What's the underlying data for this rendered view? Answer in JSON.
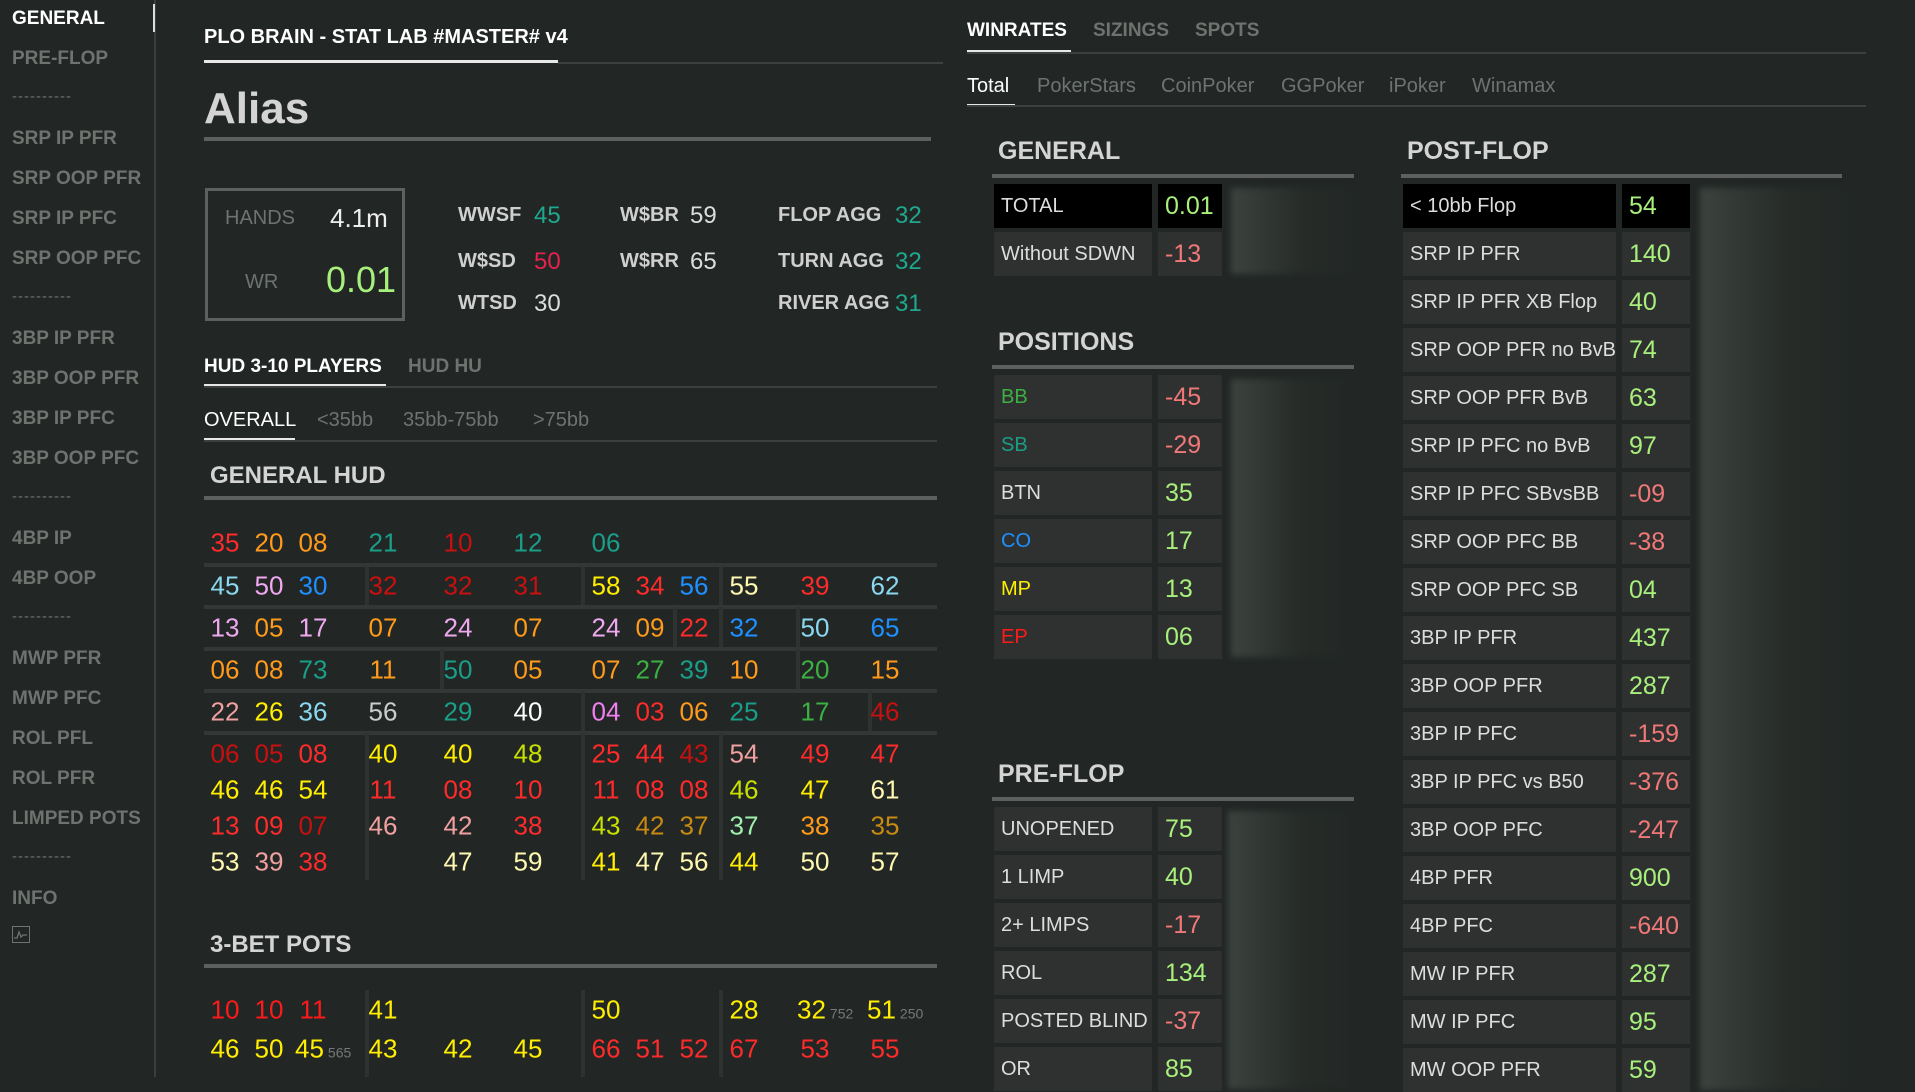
{
  "sidebar": {
    "items": [
      "GENERAL",
      "PRE-FLOP",
      "----------",
      "SRP IP PFR",
      "SRP OOP PFR",
      "SRP IP PFC",
      "SRP OOP PFC",
      "----------",
      "3BP IP PFR",
      "3BP OOP PFR",
      "3BP IP PFC",
      "3BP OOP PFC",
      "----------",
      "4BP IP",
      "4BP OOP",
      "----------",
      "MWP PFR",
      "MWP PFC",
      "ROL PFL",
      "ROL PFR",
      "LIMPED POTS",
      "----------",
      "INFO"
    ],
    "active": 0,
    "icon": "chart-icon"
  },
  "header": {
    "title": "PLO BRAIN - STAT LAB #MASTER# v4",
    "alias": "Alias"
  },
  "summary": {
    "hands_label": "HANDS",
    "hands": "4.1m",
    "wr_label": "WR",
    "wr": "0.01"
  },
  "stats": [
    {
      "label": "WWSF",
      "value": "45",
      "color": "#1fa88f"
    },
    {
      "label": "W$SD",
      "value": "50",
      "color": "#e8204f"
    },
    {
      "label": "WTSD",
      "value": "30",
      "color": "#dddddd"
    },
    {
      "label": "W$BR",
      "value": "59",
      "color": "#dddddd"
    },
    {
      "label": "W$RR",
      "value": "65",
      "color": "#dddddd"
    },
    {
      "label": "FLOP AGG",
      "value": "32",
      "color": "#1fa88f"
    },
    {
      "label": "TURN AGG",
      "value": "32",
      "color": "#1fa88f"
    },
    {
      "label": "RIVER AGG",
      "value": "31",
      "color": "#1fa88f"
    }
  ],
  "hud_tabs": [
    "HUD 3-10 PLAYERS",
    "HUD HU"
  ],
  "stack_tabs": [
    "OVERALL",
    "<35bb",
    "35bb-75bb",
    ">75bb"
  ],
  "general_hud": {
    "title": "GENERAL HUD",
    "rows": [
      [
        [
          0,
          "35",
          "#ff2a2a"
        ],
        [
          1,
          "20",
          "#ff9a1a"
        ],
        [
          2,
          "08",
          "#ff9a1a"
        ],
        [
          3,
          "21",
          "#1a9e88"
        ],
        [
          4,
          "10",
          "#c81010"
        ],
        [
          5,
          "12",
          "#1a9e88"
        ],
        [
          6,
          "06",
          "#1a9e88"
        ]
      ],
      [
        [
          0,
          "45",
          "#8ad8f0"
        ],
        [
          1,
          "50",
          "#f0a8f0"
        ],
        [
          2,
          "30",
          "#1e90ff"
        ],
        [
          3,
          "32",
          "#c81010"
        ],
        [
          4,
          "32",
          "#c81010"
        ],
        [
          5,
          "31",
          "#c81010"
        ],
        [
          6,
          "58",
          "#ffee00"
        ],
        [
          7,
          "34",
          "#ff2a2a"
        ],
        [
          8,
          "56",
          "#1e90ff"
        ],
        [
          9,
          "55",
          "#fff8b0"
        ],
        [
          10,
          "39",
          "#ff2a2a"
        ],
        [
          11,
          "62",
          "#8ad8f0"
        ]
      ],
      [
        [
          0,
          "13",
          "#f0a8f0"
        ],
        [
          1,
          "05",
          "#ff9a1a"
        ],
        [
          2,
          "17",
          "#f0a8f0"
        ],
        [
          3,
          "07",
          "#ff9a1a"
        ],
        [
          4,
          "24",
          "#f0a8f0"
        ],
        [
          5,
          "07",
          "#ff9a1a"
        ],
        [
          6,
          "24",
          "#f0a8f0"
        ],
        [
          7,
          "09",
          "#ff9a1a"
        ],
        [
          8,
          "22",
          "#ff2a2a"
        ],
        [
          9,
          "32",
          "#1e90ff"
        ],
        [
          10,
          "50",
          "#8ad8f0"
        ],
        [
          11,
          "65",
          "#1e90ff"
        ]
      ],
      [
        [
          0,
          "06",
          "#ff9a1a"
        ],
        [
          1,
          "08",
          "#ff9a1a"
        ],
        [
          2,
          "73",
          "#1a9e88"
        ],
        [
          3,
          "11",
          "#ff9a1a"
        ],
        [
          4,
          "50",
          "#1a9e88"
        ],
        [
          5,
          "05",
          "#ff9a1a"
        ],
        [
          6,
          "07",
          "#ff9a1a"
        ],
        [
          7,
          "27",
          "#3cb043"
        ],
        [
          8,
          "39",
          "#1a9e88"
        ],
        [
          9,
          "10",
          "#ff9a1a"
        ],
        [
          10,
          "20",
          "#3cb043"
        ],
        [
          11,
          "15",
          "#ff9a1a"
        ]
      ],
      [
        [
          0,
          "22",
          "#f0a0a0"
        ],
        [
          1,
          "26",
          "#ffee00"
        ],
        [
          2,
          "36",
          "#8ad8f0"
        ],
        [
          3,
          "56",
          "#cccccc"
        ],
        [
          4,
          "29",
          "#1a9e88"
        ],
        [
          5,
          "40",
          "#ffffff"
        ],
        [
          6,
          "04",
          "#f080f0"
        ],
        [
          7,
          "03",
          "#ff2a2a"
        ],
        [
          8,
          "06",
          "#ff9a1a"
        ],
        [
          9,
          "25",
          "#1a9e88"
        ],
        [
          10,
          "17",
          "#3cb043"
        ],
        [
          11,
          "46",
          "#c81010"
        ]
      ],
      [
        [
          0,
          "06",
          "#c81010"
        ],
        [
          1,
          "05",
          "#c81010"
        ],
        [
          2,
          "08",
          "#ff2a2a"
        ],
        [
          3,
          "40",
          "#ffee00"
        ],
        [
          4,
          "40",
          "#ffee00"
        ],
        [
          5,
          "48",
          "#c8e000"
        ],
        [
          6,
          "25",
          "#ff2a2a"
        ],
        [
          7,
          "44",
          "#ff2a2a"
        ],
        [
          8,
          "43",
          "#c81010"
        ],
        [
          9,
          "54",
          "#f0a0a0"
        ],
        [
          10,
          "49",
          "#ff2a2a"
        ],
        [
          11,
          "47",
          "#ff2a2a"
        ]
      ],
      [
        [
          0,
          "46",
          "#ffee00"
        ],
        [
          1,
          "46",
          "#ffee00"
        ],
        [
          2,
          "54",
          "#ffee00"
        ],
        [
          3,
          "11",
          "#ff2a2a"
        ],
        [
          4,
          "08",
          "#ff2a2a"
        ],
        [
          5,
          "10",
          "#ff2a2a"
        ],
        [
          6,
          "11",
          "#ff2a2a"
        ],
        [
          7,
          "08",
          "#ff2a2a"
        ],
        [
          8,
          "08",
          "#ff2a2a"
        ],
        [
          9,
          "46",
          "#c8e000"
        ],
        [
          10,
          "47",
          "#ffee00"
        ],
        [
          11,
          "61",
          "#fff8b0"
        ]
      ],
      [
        [
          0,
          "13",
          "#ff2a2a"
        ],
        [
          1,
          "09",
          "#ff2a2a"
        ],
        [
          2,
          "07",
          "#c81010"
        ],
        [
          3,
          "46",
          "#f0a0a0"
        ],
        [
          4,
          "42",
          "#f0a0a0"
        ],
        [
          5,
          "38",
          "#ff2a2a"
        ],
        [
          6,
          "43",
          "#c8e000"
        ],
        [
          7,
          "42",
          "#c88a10"
        ],
        [
          8,
          "37",
          "#c88a10"
        ],
        [
          9,
          "37",
          "#a0f0b0"
        ],
        [
          10,
          "38",
          "#ff9a1a"
        ],
        [
          11,
          "35",
          "#c88a10"
        ]
      ],
      [
        [
          0,
          "53",
          "#fff8b0"
        ],
        [
          1,
          "39",
          "#f0a0a0"
        ],
        [
          2,
          "38",
          "#ff2a2a"
        ],
        [
          4,
          "47",
          "#fff8b0"
        ],
        [
          5,
          "59",
          "#fff8b0"
        ],
        [
          6,
          "41",
          "#ffee00"
        ],
        [
          7,
          "47",
          "#fff8b0"
        ],
        [
          8,
          "56",
          "#fff8b0"
        ],
        [
          9,
          "44",
          "#ffee00"
        ],
        [
          10,
          "50",
          "#fff8b0"
        ],
        [
          11,
          "57",
          "#fff8b0"
        ]
      ]
    ]
  },
  "three_bet": {
    "title": "3-BET POTS",
    "rows": [
      [
        [
          0,
          "10",
          "#ff1a1a"
        ],
        [
          1,
          "10",
          "#ff1a1a"
        ],
        [
          2,
          "11",
          "#ff1a1a"
        ],
        [
          3,
          "41",
          "#ffee00"
        ],
        [
          6,
          "50",
          "#ffee00"
        ],
        [
          9,
          "28",
          "#ffee00"
        ],
        [
          10,
          "32",
          "#ffee00",
          "752"
        ],
        [
          11,
          "51",
          "#ffee00",
          "250"
        ]
      ],
      [
        [
          0,
          "46",
          "#ffee00"
        ],
        [
          1,
          "50",
          "#ffee00"
        ],
        [
          2,
          "45",
          "#ffee00",
          "565"
        ],
        [
          3,
          "43",
          "#ffee00"
        ],
        [
          4,
          "42",
          "#ffee00"
        ],
        [
          5,
          "45",
          "#ffee00"
        ],
        [
          6,
          "66",
          "#ff2a2a"
        ],
        [
          7,
          "51",
          "#ff2a2a"
        ],
        [
          8,
          "52",
          "#ff2a2a"
        ],
        [
          9,
          "67",
          "#ff2a2a"
        ],
        [
          10,
          "53",
          "#ff2a2a"
        ],
        [
          11,
          "55",
          "#ff2a2a"
        ]
      ]
    ]
  },
  "right_tabs": [
    "WINRATES",
    "SIZINGS",
    "SPOTS"
  ],
  "site_tabs": [
    "Total",
    "PokerStars",
    "CoinPoker",
    "GGPoker",
    "iPoker",
    "Winamax"
  ],
  "panels": {
    "general": {
      "title": "GENERAL",
      "rows": [
        {
          "label": "TOTAL",
          "value": "0.01",
          "highlight": true
        },
        {
          "label": "Without SDWN",
          "value": "-13"
        }
      ]
    },
    "positions": {
      "title": "POSITIONS",
      "rows": [
        {
          "label": "BB",
          "value": "-45",
          "color": "#3cb043"
        },
        {
          "label": "SB",
          "value": "-29",
          "color": "#1a9e88"
        },
        {
          "label": "BTN",
          "value": "35"
        },
        {
          "label": "CO",
          "value": "17",
          "color": "#1e90ff"
        },
        {
          "label": "MP",
          "value": "13",
          "color": "#ffee00"
        },
        {
          "label": "EP",
          "value": "06",
          "color": "#ff1a1a"
        }
      ]
    },
    "preflop": {
      "title": "PRE-FLOP",
      "rows": [
        {
          "label": "UNOPENED",
          "value": "75"
        },
        {
          "label": "1 LIMP",
          "value": "40"
        },
        {
          "label": "2+ LIMPS",
          "value": "-17"
        },
        {
          "label": "ROL",
          "value": "134"
        },
        {
          "label": "POSTED BLIND",
          "value": "-37"
        },
        {
          "label": "OR",
          "value": "85"
        }
      ]
    },
    "postflop": {
      "title": "POST-FLOP",
      "rows": [
        {
          "label": "< 10bb Flop",
          "value": "54",
          "highlight": true
        },
        {
          "label": "SRP IP PFR",
          "value": "140"
        },
        {
          "label": "SRP IP PFR XB Flop",
          "value": "40"
        },
        {
          "label": "SRP OOP PFR no BvB",
          "value": "74"
        },
        {
          "label": "SRP OOP PFR BvB",
          "value": "63"
        },
        {
          "label": "SRP IP PFC no BvB",
          "value": "97"
        },
        {
          "label": "SRP IP PFC SBvsBB",
          "value": "-09"
        },
        {
          "label": "SRP OOP PFC BB",
          "value": "-38"
        },
        {
          "label": "SRP OOP PFC SB",
          "value": "04"
        },
        {
          "label": "3BP IP PFR",
          "value": "437"
        },
        {
          "label": "3BP OOP PFR",
          "value": "287"
        },
        {
          "label": "3BP IP PFC",
          "value": "-159"
        },
        {
          "label": "3BP IP PFC vs B50",
          "value": "-376"
        },
        {
          "label": "3BP OOP PFC",
          "value": "-247"
        },
        {
          "label": "4BP PFR",
          "value": "900"
        },
        {
          "label": "4BP PFC",
          "value": "-640"
        },
        {
          "label": "MW IP PFR",
          "value": "287"
        },
        {
          "label": "MW IP PFC",
          "value": "95"
        },
        {
          "label": "MW OOP PFR",
          "value": "59"
        }
      ]
    }
  },
  "colors": {
    "positive": "#a8f07c",
    "negative": "#f07878"
  }
}
